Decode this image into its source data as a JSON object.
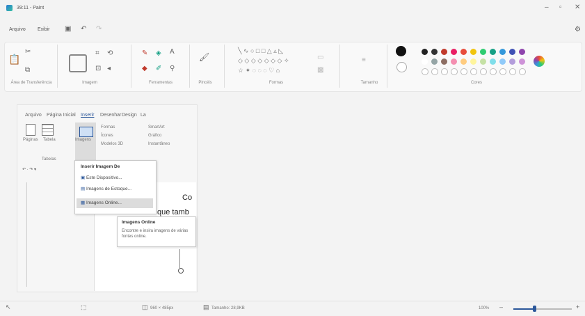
{
  "window": {
    "title": "39:11 - Paint",
    "app_icon": "paint-app-icon"
  },
  "menu": {
    "file": "Arquivo",
    "edit": "Exibir"
  },
  "ribbon_groups": {
    "clipboard": "Área de Transferência",
    "image": "Imagem",
    "tools": "Ferramentas",
    "brushes": "Pincéis",
    "shapes": "Formas",
    "size": "Tamanho",
    "colors": "Cores"
  },
  "palette": {
    "primary": "#111111",
    "secondary": "#ffffff",
    "row1": [
      "#222222",
      "#333333",
      "#c0392b",
      "#e91e63",
      "#e74c3c",
      "#f1c40f",
      "#2ecc71",
      "#16a085",
      "#3498db",
      "#3f51b5",
      "#8e44ad"
    ],
    "row2": [
      "#ffffff",
      "#95a5a6",
      "#8d6e63",
      "#f48fb1",
      "#ffcc80",
      "#fff59d",
      "#c5e1a5",
      "#80deea",
      "#90caf9",
      "#b39ddb",
      "#ce93d8"
    ]
  },
  "word": {
    "tabs": [
      "Arquivo",
      "Página Inicial",
      "Inserir",
      "Desenhar",
      "Design",
      "La"
    ],
    "active_tab": "Inserir",
    "buttons": {
      "pages": "Páginas",
      "table": "Tabela",
      "images": "Imagens",
      "shapes": "Formas",
      "icons": "Ícones",
      "models3d": "Modelos 3D",
      "smartart": "SmartArt",
      "chart": "Gráfico",
      "screenshot": "Instantâneo"
    },
    "group_tables": "Tabelas",
    "doc_text1": "Co",
    "doc_text2": "que tamb"
  },
  "insert_menu": {
    "header": "Inserir Imagem De",
    "items": [
      "Este Dispositivo...",
      "Imagens de Estoque...",
      "Imagens Online..."
    ]
  },
  "tooltip": {
    "title": "Imagens Online",
    "body": "Encontre e insira imagens de várias fontes online."
  },
  "status": {
    "dimensions": "960 × 485px",
    "size": "Tamanho: 28,9KB",
    "zoom": "100%"
  }
}
